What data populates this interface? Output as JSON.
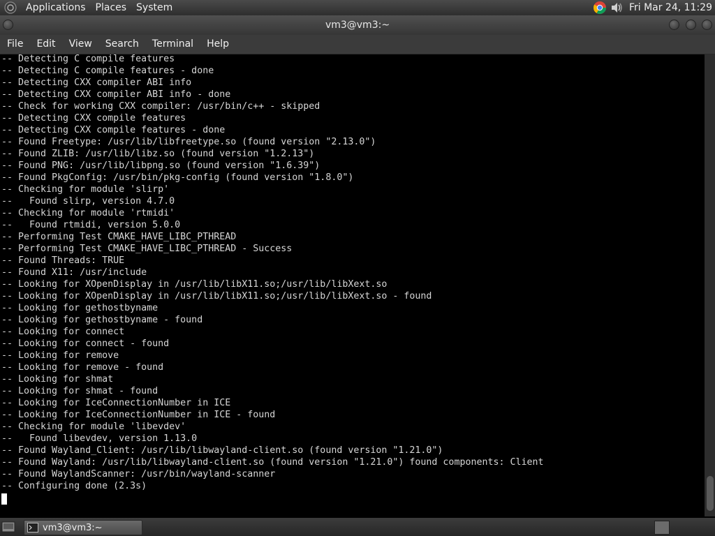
{
  "top_panel": {
    "menus": [
      "Applications",
      "Places",
      "System"
    ],
    "clock": "Fri Mar 24, 11:29",
    "tray_icons": [
      "chrome-icon",
      "volume-icon"
    ]
  },
  "window": {
    "title": "vm3@vm3:~"
  },
  "menubar": {
    "items": [
      "File",
      "Edit",
      "View",
      "Search",
      "Terminal",
      "Help"
    ]
  },
  "terminal": {
    "lines": [
      "-- Detecting C compile features",
      "-- Detecting C compile features - done",
      "-- Detecting CXX compiler ABI info",
      "-- Detecting CXX compiler ABI info - done",
      "-- Check for working CXX compiler: /usr/bin/c++ - skipped",
      "-- Detecting CXX compile features",
      "-- Detecting CXX compile features - done",
      "-- Found Freetype: /usr/lib/libfreetype.so (found version \"2.13.0\")",
      "-- Found ZLIB: /usr/lib/libz.so (found version \"1.2.13\")",
      "-- Found PNG: /usr/lib/libpng.so (found version \"1.6.39\")",
      "-- Found PkgConfig: /usr/bin/pkg-config (found version \"1.8.0\")",
      "-- Checking for module 'slirp'",
      "--   Found slirp, version 4.7.0",
      "-- Checking for module 'rtmidi'",
      "--   Found rtmidi, version 5.0.0",
      "-- Performing Test CMAKE_HAVE_LIBC_PTHREAD",
      "-- Performing Test CMAKE_HAVE_LIBC_PTHREAD - Success",
      "-- Found Threads: TRUE",
      "-- Found X11: /usr/include",
      "-- Looking for XOpenDisplay in /usr/lib/libX11.so;/usr/lib/libXext.so",
      "-- Looking for XOpenDisplay in /usr/lib/libX11.so;/usr/lib/libXext.so - found",
      "-- Looking for gethostbyname",
      "-- Looking for gethostbyname - found",
      "-- Looking for connect",
      "-- Looking for connect - found",
      "-- Looking for remove",
      "-- Looking for remove - found",
      "-- Looking for shmat",
      "-- Looking for shmat - found",
      "-- Looking for IceConnectionNumber in ICE",
      "-- Looking for IceConnectionNumber in ICE - found",
      "-- Checking for module 'libevdev'",
      "--   Found libevdev, version 1.13.0",
      "-- Found Wayland_Client: /usr/lib/libwayland-client.so (found version \"1.21.0\")",
      "-- Found Wayland: /usr/lib/libwayland-client.so (found version \"1.21.0\") found components: Client",
      "-- Found WaylandScanner: /usr/bin/wayland-scanner",
      "-- Configuring done (2.3s)"
    ]
  },
  "taskbar": {
    "task_label": "vm3@vm3:~"
  }
}
